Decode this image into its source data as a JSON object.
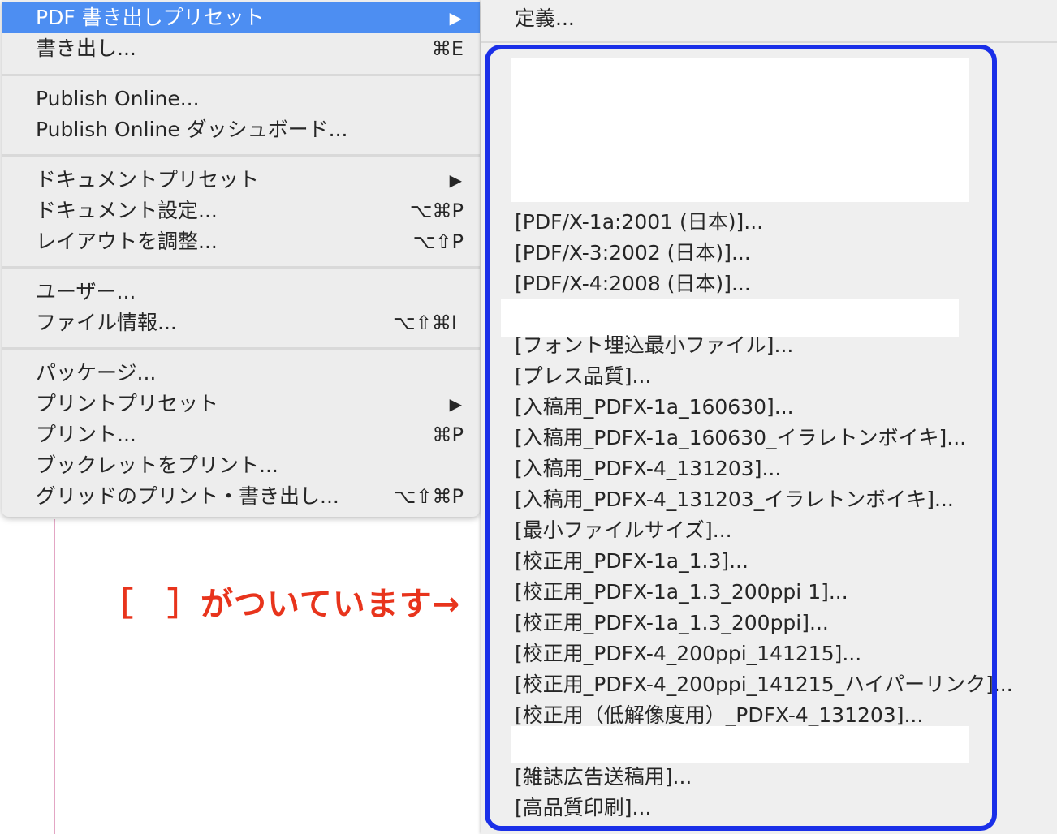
{
  "main_menu": {
    "items": [
      {
        "label": "PDF 書き出しプリセット",
        "shortcut": "",
        "arrow": "▶"
      },
      {
        "label": "書き出し...",
        "shortcut": "⌘E",
        "arrow": ""
      },
      {
        "label": "Publish Online...",
        "shortcut": "",
        "arrow": ""
      },
      {
        "label": "Publish Online ダッシュボード...",
        "shortcut": "",
        "arrow": ""
      },
      {
        "label": "ドキュメントプリセット",
        "shortcut": "",
        "arrow": "▶"
      },
      {
        "label": "ドキュメント設定...",
        "shortcut": "⌥⌘P",
        "arrow": ""
      },
      {
        "label": "レイアウトを調整...",
        "shortcut": "⌥⇧P",
        "arrow": ""
      },
      {
        "label": "ユーザー...",
        "shortcut": "",
        "arrow": ""
      },
      {
        "label": "ファイル情報...",
        "shortcut": "⌥⇧⌘I",
        "arrow": ""
      },
      {
        "label": "パッケージ...",
        "shortcut": "",
        "arrow": ""
      },
      {
        "label": "プリントプリセット",
        "shortcut": "",
        "arrow": "▶"
      },
      {
        "label": "プリント...",
        "shortcut": "⌘P",
        "arrow": ""
      },
      {
        "label": "ブックレットをプリント...",
        "shortcut": "",
        "arrow": ""
      },
      {
        "label": "グリッドのプリント・書き出し...",
        "shortcut": "⌥⇧⌘P",
        "arrow": ""
      }
    ]
  },
  "submenu": {
    "define_label": "定義...",
    "presets": [
      "[PDF/X-1a:2001 (日本)]...",
      "[PDF/X-3:2002 (日本)]...",
      "[PDF/X-4:2008 (日本)]...",
      "[フォント埋込最小ファイル]...",
      "[プレス品質]...",
      "[入稿用_PDFX-1a_160630]...",
      "[入稿用_PDFX-1a_160630_イラレトンボイキ]...",
      "[入稿用_PDFX-4_131203]...",
      "[入稿用_PDFX-4_131203_イラレトンボイキ]...",
      "[最小ファイルサイズ]...",
      "[校正用_PDFX-1a_1.3]...",
      "[校正用_PDFX-1a_1.3_200ppi 1]...",
      "[校正用_PDFX-1a_1.3_200ppi]...",
      "[校正用_PDFX-4_200ppi_141215]...",
      "[校正用_PDFX-4_200ppi_141215_ハイパーリンク]...",
      "[校正用（低解像度用）_PDFX-4_131203]...",
      "[雑誌広告送稿用]...",
      "[高品質印刷]..."
    ]
  },
  "annotation": {
    "text": "［　］がついています→"
  },
  "colors": {
    "highlight": "#4d8ef2",
    "callout_box": "#1a2fe8",
    "annotation_text": "#e8341c"
  }
}
